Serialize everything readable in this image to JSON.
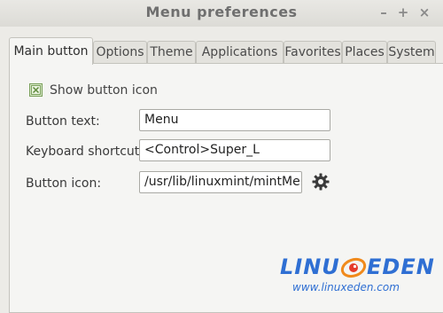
{
  "window": {
    "title": "Menu preferences",
    "controls": [
      "–",
      "+",
      "×"
    ]
  },
  "tabs": [
    {
      "label": "Main button",
      "active": true
    },
    {
      "label": "Options",
      "active": false
    },
    {
      "label": "Theme",
      "active": false
    },
    {
      "label": "Applications",
      "active": false
    },
    {
      "label": "Favorites",
      "active": false
    },
    {
      "label": "Places",
      "active": false
    },
    {
      "label": "System",
      "active": false
    }
  ],
  "main_button": {
    "show_icon": {
      "label": "Show button icon",
      "checked": true
    },
    "button_text": {
      "label": "Button text:",
      "value": "Menu"
    },
    "keyboard_shortcut": {
      "label": "Keyboard shortcut:",
      "value": "<Control>Super_L"
    },
    "button_icon": {
      "label": "Button icon:",
      "value": "/usr/lib/linuxmint/mintMenu",
      "browse_icon": "gear-icon"
    }
  },
  "watermark": {
    "logo_left": "LINU",
    "logo_right": "EDEN",
    "url": "www.linuxeden.com"
  },
  "colors": {
    "window_bg": "#ecebe7",
    "panel_bg": "#f5f5f3",
    "checkbox_green": "#7aa05a",
    "logo_blue": "#2f6fd3",
    "logo_orange": "#f08a1c"
  }
}
